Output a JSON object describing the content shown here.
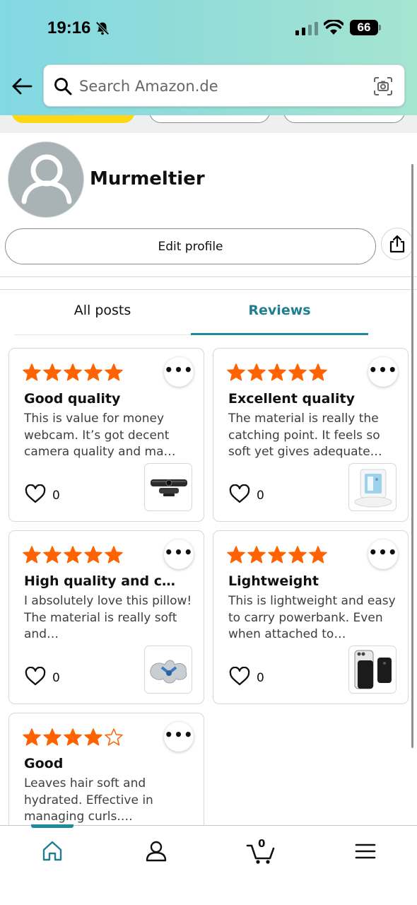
{
  "status_bar": {
    "time": "19:16",
    "battery": "66"
  },
  "search": {
    "placeholder": "Search Amazon.de"
  },
  "profile": {
    "name": "Murmeltier",
    "edit_label": "Edit profile"
  },
  "tabs": [
    {
      "label": "All posts",
      "active": false
    },
    {
      "label": "Reviews",
      "active": true
    }
  ],
  "reviews": [
    {
      "rating": 5,
      "title": "Good quality",
      "body": "This is value for money webcam. It’s got decent camera quality and ma…",
      "likes": "0",
      "product_icon": "webcam"
    },
    {
      "rating": 5,
      "title": "Excellent quality",
      "body": "The material is really the catching point. It feels so soft yet gives adequate…",
      "likes": "0",
      "product_icon": "pillow"
    },
    {
      "rating": 5,
      "title": "High quality and co…",
      "body": "I absolutely love this pillow! The material is really soft and…",
      "likes": "0",
      "product_icon": "travel-pillow"
    },
    {
      "rating": 5,
      "title": "Lightweight",
      "body": "This is lightweight and easy to carry powerbank. Even when attached to…",
      "likes": "0",
      "product_icon": "powerbank"
    },
    {
      "rating": 4,
      "title": "Good",
      "body": "Leaves hair soft and hydrated. Effective in managing curls.…",
      "likes": "",
      "product_icon": ""
    }
  ],
  "bottom_nav": {
    "cart_count": "0",
    "items": [
      "home-icon",
      "profile-icon",
      "cart-icon",
      "menu-icon"
    ]
  },
  "colors": {
    "accent": "#1f8a9b",
    "star": "#ff6200",
    "chip": "#ffd814"
  }
}
